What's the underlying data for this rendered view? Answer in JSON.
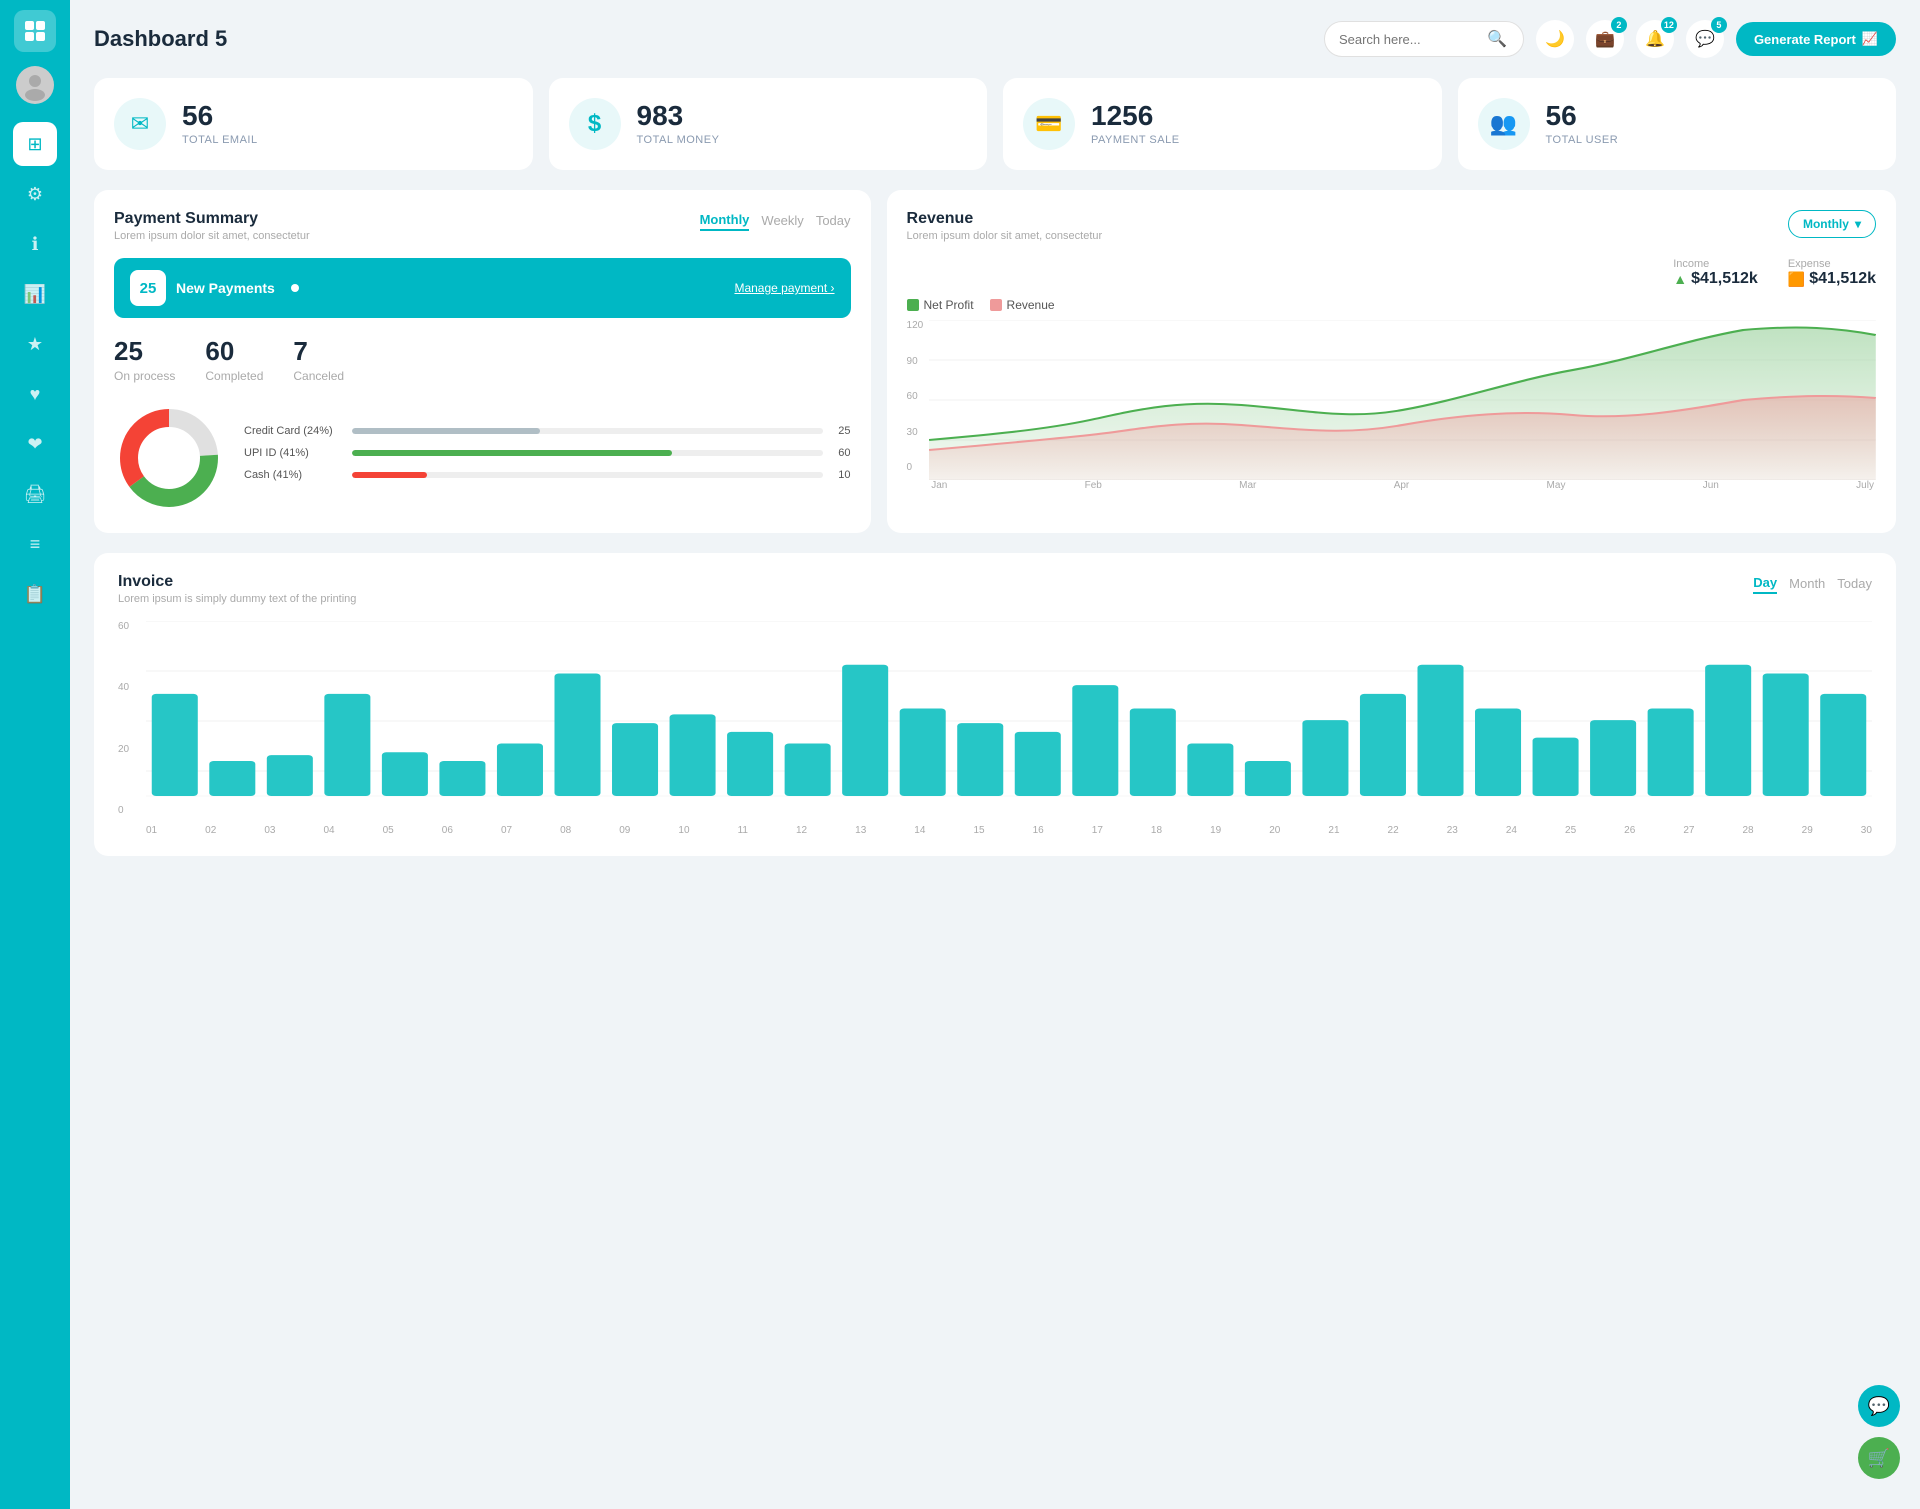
{
  "app": {
    "title": "Dashboard 5"
  },
  "header": {
    "search_placeholder": "Search here...",
    "generate_btn": "Generate Report",
    "badge_wallet": "2",
    "badge_bell": "12",
    "badge_chat": "5"
  },
  "stats": [
    {
      "id": "email",
      "value": "56",
      "label": "TOTAL EMAIL",
      "icon": "✉"
    },
    {
      "id": "money",
      "value": "983",
      "label": "TOTAL MONEY",
      "icon": "$"
    },
    {
      "id": "payment",
      "value": "1256",
      "label": "PAYMENT SALE",
      "icon": "💳"
    },
    {
      "id": "user",
      "value": "56",
      "label": "TOTAL USER",
      "icon": "👥"
    }
  ],
  "payment_summary": {
    "title": "Payment Summary",
    "subtitle": "Lorem ipsum dolor sit amet, consectetur",
    "tabs": [
      "Monthly",
      "Weekly",
      "Today"
    ],
    "active_tab": "Monthly",
    "new_payments_count": "25",
    "new_payments_label": "New Payments",
    "manage_link": "Manage payment",
    "on_process": "25",
    "on_process_label": "On process",
    "completed": "60",
    "completed_label": "Completed",
    "canceled": "7",
    "canceled_label": "Canceled",
    "payment_methods": [
      {
        "label": "Credit Card (24%)",
        "pct": 24,
        "color": "#b0bec5",
        "value": "25"
      },
      {
        "label": "UPI ID (41%)",
        "pct": 41,
        "color": "#4caf50",
        "value": "60"
      },
      {
        "label": "Cash (41%)",
        "pct": 10,
        "color": "#f44336",
        "value": "10"
      }
    ]
  },
  "revenue": {
    "title": "Revenue",
    "subtitle": "Lorem ipsum dolor sit amet, consectetur",
    "active_tab": "Monthly",
    "income_label": "Income",
    "income_value": "$41,512k",
    "expense_label": "Expense",
    "expense_value": "$41,512k",
    "legend": [
      {
        "label": "Net Profit",
        "color": "#a5d6a7"
      },
      {
        "label": "Revenue",
        "color": "#ef9a9a"
      }
    ],
    "x_labels": [
      "Jan",
      "Feb",
      "Mar",
      "Apr",
      "May",
      "Jun",
      "July"
    ],
    "y_labels": [
      "0",
      "30",
      "60",
      "90",
      "120"
    ]
  },
  "invoice": {
    "title": "Invoice",
    "subtitle": "Lorem ipsum is simply dummy text of the printing",
    "tabs": [
      "Day",
      "Month",
      "Today"
    ],
    "active_tab": "Day",
    "x_labels": [
      "01",
      "02",
      "03",
      "04",
      "05",
      "06",
      "07",
      "08",
      "09",
      "10",
      "11",
      "12",
      "13",
      "14",
      "15",
      "16",
      "17",
      "18",
      "19",
      "20",
      "21",
      "22",
      "23",
      "24",
      "25",
      "26",
      "27",
      "28",
      "29",
      "30"
    ],
    "y_labels": [
      "0",
      "20",
      "40",
      "60"
    ],
    "bars": [
      35,
      12,
      14,
      35,
      15,
      12,
      18,
      42,
      25,
      28,
      22,
      18,
      45,
      30,
      25,
      22,
      38,
      30,
      18,
      12,
      26,
      35,
      45,
      30,
      20,
      26,
      30,
      45,
      42,
      35
    ]
  }
}
